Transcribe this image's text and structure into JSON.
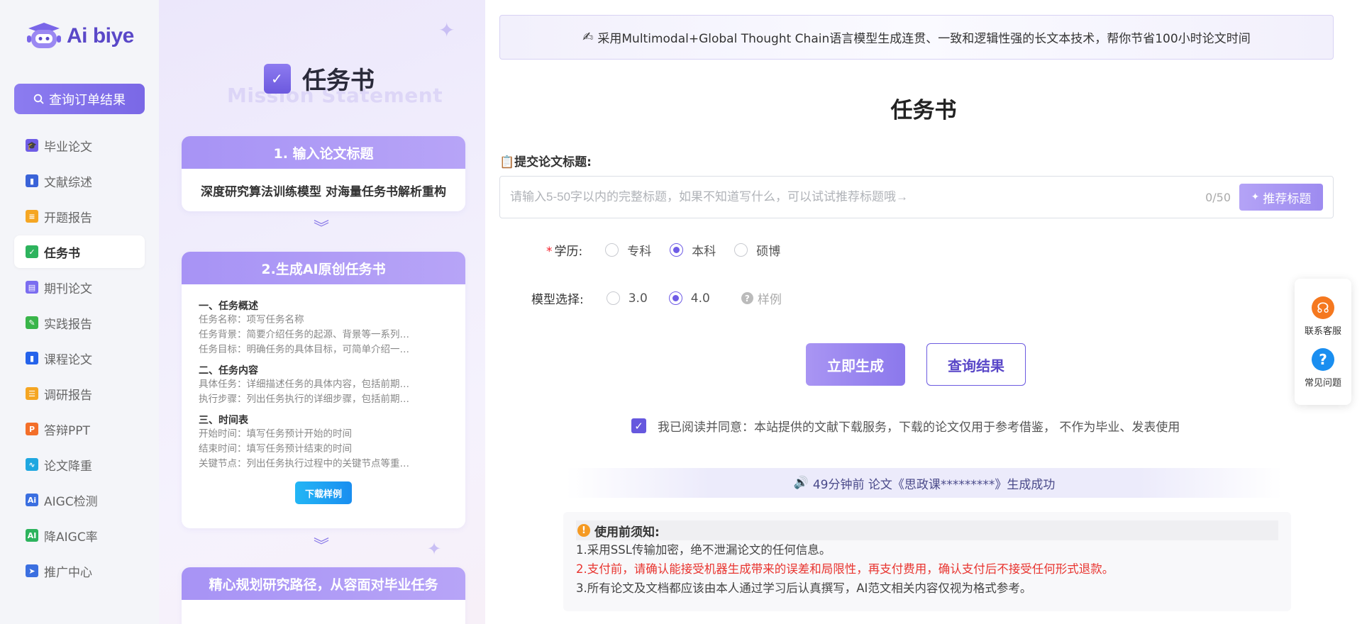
{
  "app": {
    "brand": "Ai biye",
    "brand_color": "#5a48c8"
  },
  "sidebar": {
    "query_button": "查询订单结果",
    "items": [
      {
        "label": "毕业论文",
        "icon": "graduation-cap-icon",
        "color": "#6f5ce6",
        "glyph": "🎓"
      },
      {
        "label": "文献综述",
        "icon": "book-icon",
        "color": "#3a63d8",
        "glyph": "▮"
      },
      {
        "label": "开题报告",
        "icon": "report-icon",
        "color": "#f5a623",
        "glyph": "≡"
      },
      {
        "label": "任务书",
        "icon": "task-check-icon",
        "color": "#2db35d",
        "glyph": "✓",
        "active": true
      },
      {
        "label": "期刊论文",
        "icon": "journal-icon",
        "color": "#7b6df0",
        "glyph": "▤"
      },
      {
        "label": "实践报告",
        "icon": "pen-doc-icon",
        "color": "#39b54a",
        "glyph": "✎"
      },
      {
        "label": "课程论文",
        "icon": "course-book-icon",
        "color": "#2563eb",
        "glyph": "▮"
      },
      {
        "label": "调研报告",
        "icon": "survey-icon",
        "color": "#f5a623",
        "glyph": "☰"
      },
      {
        "label": "答辩PPT",
        "icon": "ppt-icon",
        "color": "#f36f2a",
        "glyph": "P"
      },
      {
        "label": "论文降重",
        "icon": "chart-icon",
        "color": "#1fa7e0",
        "glyph": "∿"
      },
      {
        "label": "AIGC检测",
        "icon": "ai-detect-icon",
        "color": "#3b6fe0",
        "glyph": "Ai"
      },
      {
        "label": "降AIGC率",
        "icon": "ai-reduce-icon",
        "color": "#2db35d",
        "glyph": "AI"
      },
      {
        "label": "推广中心",
        "icon": "paper-plane-icon",
        "color": "#3b6fe0",
        "glyph": "➤"
      }
    ]
  },
  "promo": {
    "title": "任务书",
    "ghost_text": "Mission Statement",
    "step1_title": "1. 输入论文标题",
    "step1_body": "深度研究算法训练模型  对海量任务书解析重构",
    "step2_title": "2.生成AI原创任务书",
    "sections": [
      {
        "title": "一、任务概述",
        "lines": [
          "任务名称：项写任务名称",
          "任务背景：简要介绍任务的起源、背景等一系列…",
          "任务目标：明确任务的具体目标，可简单介绍一…"
        ]
      },
      {
        "title": "二、任务内容",
        "lines": [
          "具体任务：详细描述任务的具体内容，包括前期…",
          "执行步骤：列出任务执行的详细步骤，包括前期…"
        ]
      },
      {
        "title": "三、时间表",
        "lines": [
          "开始时间：填写任务预计开始的时间",
          "结束时间：填写任务预计结束的时间",
          "关键节点：列出任务执行过程中的关键节点等重…"
        ]
      }
    ],
    "download_button": "下载样例",
    "step3_title": "精心规划研究路径，从容面对毕业任务"
  },
  "main": {
    "banner": "采用Multimodal+Global Thought Chain语言模型生成连贯、一致和逻辑性强的长文本技术，帮你节省100小时论文时间",
    "page_title": "任务书",
    "title_label": "提交论文标题:",
    "title_placeholder": "请输入5-50字以内的完整标题，如果不知道写什么，可以试试推荐标题哦→",
    "title_counter": "0/50",
    "recommend_button": "推荐标题",
    "education_label": "学历:",
    "education_options": [
      "专科",
      "本科",
      "硕博"
    ],
    "education_selected": "本科",
    "model_label": "模型选择:",
    "model_options": [
      "3.0",
      "4.0"
    ],
    "model_selected": "4.0",
    "sample_label": "样例",
    "generate_button": "立即生成",
    "query_button": "查询结果",
    "agreement": "我已阅读并同意：本站提供的文献下载服务，下载的论文仅用于参考借鉴， 不作为毕业、发表使用",
    "ticker": "49分钟前 论文《思政课*********》生成成功",
    "notice_title": "使用前须知:",
    "notice_lines": [
      "1.采用SSL传输加密，绝不泄漏论文的任何信息。",
      "2.支付前，请确认能接受机器生成带来的误差和局限性，再支付费用，确认支付后不接受任何形式退款。",
      "3.所有论文及文档都应该由本人通过学习后认真撰写，AI范文相关内容仅视为格式参考。"
    ]
  },
  "float": {
    "service_label": "联系客服",
    "faq_label": "常见问题"
  }
}
